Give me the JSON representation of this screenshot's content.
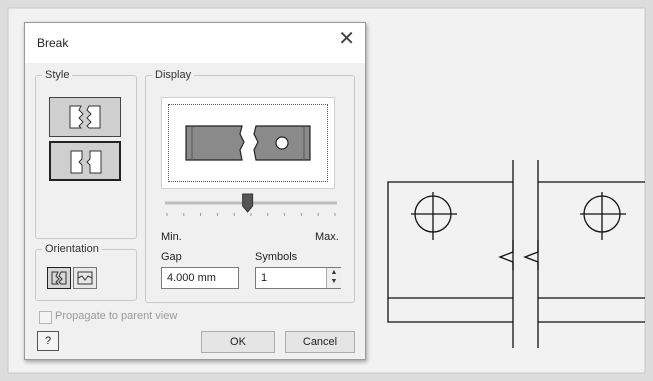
{
  "dialog": {
    "title": "Break",
    "close_glyph": "✕",
    "style_group_label": "Style",
    "display_group_label": "Display",
    "orientation_group_label": "Orientation",
    "slider": {
      "min_label": "Min.",
      "max_label": "Max.",
      "level": 0.48
    },
    "gap": {
      "label": "Gap",
      "value": "4.000 mm"
    },
    "symbols": {
      "label": "Symbols",
      "value": "1"
    },
    "propagate_label": "Propagate to parent view",
    "propagate_checked": false,
    "help_glyph": "?",
    "ok_label": "OK",
    "cancel_label": "Cancel"
  },
  "icons": [
    "close-icon",
    "rectangular-break-style-icon",
    "structural-break-style-icon",
    "horizontal-orientation-icon",
    "vertical-orientation-icon",
    "help-icon",
    "spinner-up-icon",
    "spinner-down-icon"
  ]
}
